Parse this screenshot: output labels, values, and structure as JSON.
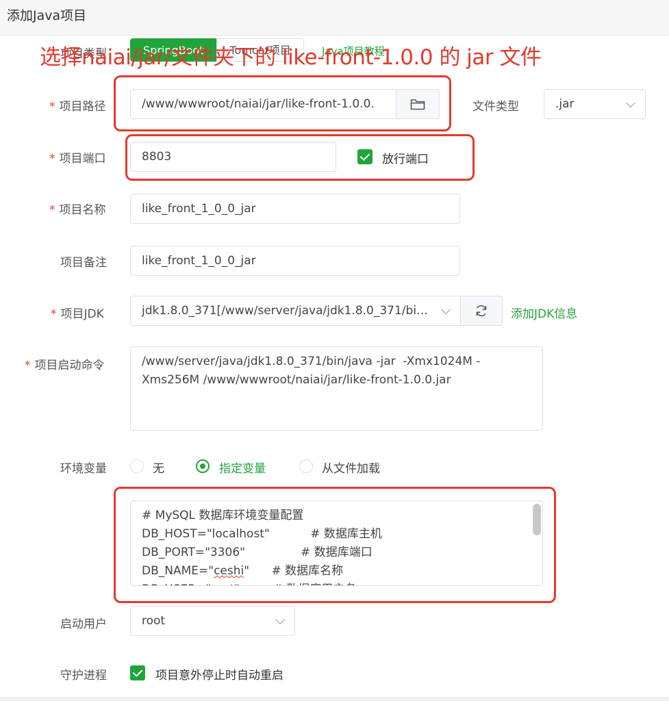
{
  "dialog": {
    "title": "添加Java项目"
  },
  "annotation": {
    "text": "选择naiai/jar/文件夹下的 like-front-1.0.0 的 jar 文件"
  },
  "project_type": {
    "label": "项目类型",
    "tabs": [
      "SpringBoot",
      "Tomcat项目"
    ],
    "active": "SpringBoot",
    "tutorial_link": "Java项目教程"
  },
  "project_path": {
    "label": "项目路径",
    "value": "/www/wwwroot/naiai/jar/like-front-1.0.0.",
    "file_type_label": "文件类型",
    "file_type_value": ".jar"
  },
  "project_port": {
    "label": "项目端口",
    "value": "8803",
    "release_port_label": "放行端口",
    "release_port_checked": true
  },
  "project_name": {
    "label": "项目名称",
    "value": "like_front_1_0_0_jar"
  },
  "project_remark": {
    "label": "项目备注",
    "value": "like_front_1_0_0_jar"
  },
  "project_jdk": {
    "label": "项目JDK",
    "value": "jdk1.8.0_371[/www/server/java/jdk1.8.0_371/bi…",
    "add_jdk_link": "添加JDK信息"
  },
  "start_command": {
    "label": "项目启动命令",
    "line1": "/www/server/java/jdk1.8.0_371/bin/java -jar  -Xmx1024M -",
    "line2": "Xms256M /www/wwwroot/naiai/jar/like-front-1.0.0.jar"
  },
  "env_vars": {
    "label": "环境变量",
    "options": [
      "无",
      "指定变量",
      "从文件加载"
    ],
    "selected": "指定变量",
    "lines": [
      "# MySQL 数据库环境变量配置",
      "DB_HOST=\"localhost\"           # 数据库主机",
      "DB_PORT=\"3306\"               # 数据库端口",
      "DB_NAME=\"",
      "DB_USER=\"root\"         # 数据库用户名"
    ],
    "db_name_value": "ceshi",
    "db_name_tail": "\"      # 数据库名称"
  },
  "start_user": {
    "label": "启动用户",
    "value": "root"
  },
  "daemon": {
    "label": "守护进程",
    "checkbox_label": "项目意外停止时自动重启",
    "checked": true
  },
  "colors": {
    "accent": "#20a53a",
    "annotation": "#e23a2c"
  }
}
